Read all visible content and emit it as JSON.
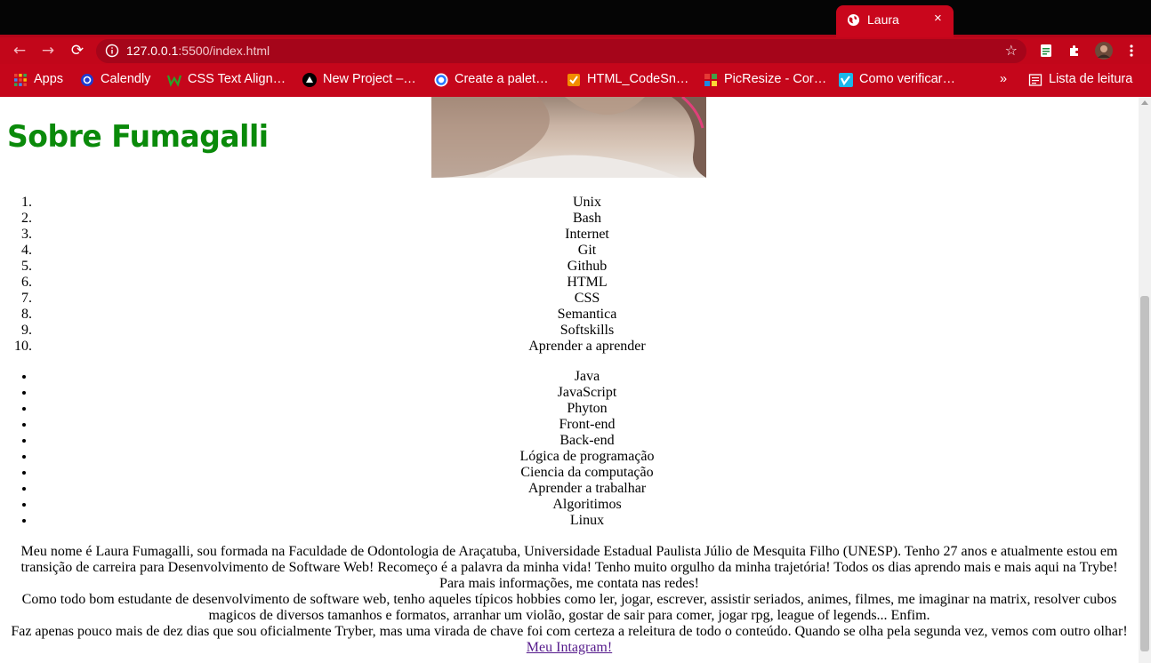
{
  "tab": {
    "title": "Laura",
    "close": "×"
  },
  "address_bar": {
    "host": "127.0.0.1",
    "path": ":5500/index.html"
  },
  "bookmarks": [
    {
      "label": "Apps",
      "icon": "apps-grid-icon"
    },
    {
      "label": "Calendly",
      "icon": "calendly-icon"
    },
    {
      "label": "CSS Text Align…",
      "icon": "w3schools-icon"
    },
    {
      "label": "New Project –…",
      "icon": "triangle-icon"
    },
    {
      "label": "Create a palet…",
      "icon": "coolors-icon"
    },
    {
      "label": "HTML_CodeSn…",
      "icon": "checkbox-icon"
    },
    {
      "label": "PicResize - Cor…",
      "icon": "picresize-icon"
    },
    {
      "label": "Como verificar…",
      "icon": "vimeo-icon"
    }
  ],
  "bookmarks_overflow": "»",
  "reading_list": "Lista de leitura",
  "page": {
    "heading": "Sobre Fumagalli",
    "ordered_list": [
      "Unix",
      "Bash",
      "Internet",
      "Git",
      "Github",
      "HTML",
      "CSS",
      "Semantica",
      "Softskills",
      "Aprender a aprender"
    ],
    "unordered_list": [
      "Java",
      "JavaScript",
      "Phyton",
      "Front-end",
      "Back-end",
      "Lógica de programação",
      "Ciencia da computação",
      "Aprender a trabalhar",
      "Algoritimos",
      "Linux"
    ],
    "bio_1": "Meu nome é Laura Fumagalli, sou formada na Faculdade de Odontologia de Araçatuba, Universidade Estadual Paulista Júlio de Mesquita Filho (UNESP). Tenho 27 anos e atualmente estou em transição de carreira para Desenvolvimento de Software Web! Recomeço é a palavra da minha vida! Tenho muito orgulho da minha trajetória! Todos os dias aprendo mais e mais aqui na Trybe! Para mais informações, me contata nas redes!",
    "bio_2": "Como todo bom estudante de desenvolvimento de software web, tenho aqueles típicos hobbies como ler, jogar, escrever, assistir seriados, animes, filmes, me imaginar na matrix, resolver cubos magicos de diversos tamanhos e formatos, arranhar um violão, gostar de sair para comer, jogar rpg, league of legends... Enfim.",
    "bio_3": "Faz apenas pouco mais de dez dias que sou oficialmente Tryber, mas uma virada de chave foi com certeza a releitura de todo o conteúdo. Quando se olha pela segunda vez, vemos com outro olhar!",
    "instagram_link": "Meu Intagram!"
  },
  "colors": {
    "chrome_red": "#c2061a",
    "heading_green": "#0a8a0a",
    "link_visited": "#551a8b"
  }
}
